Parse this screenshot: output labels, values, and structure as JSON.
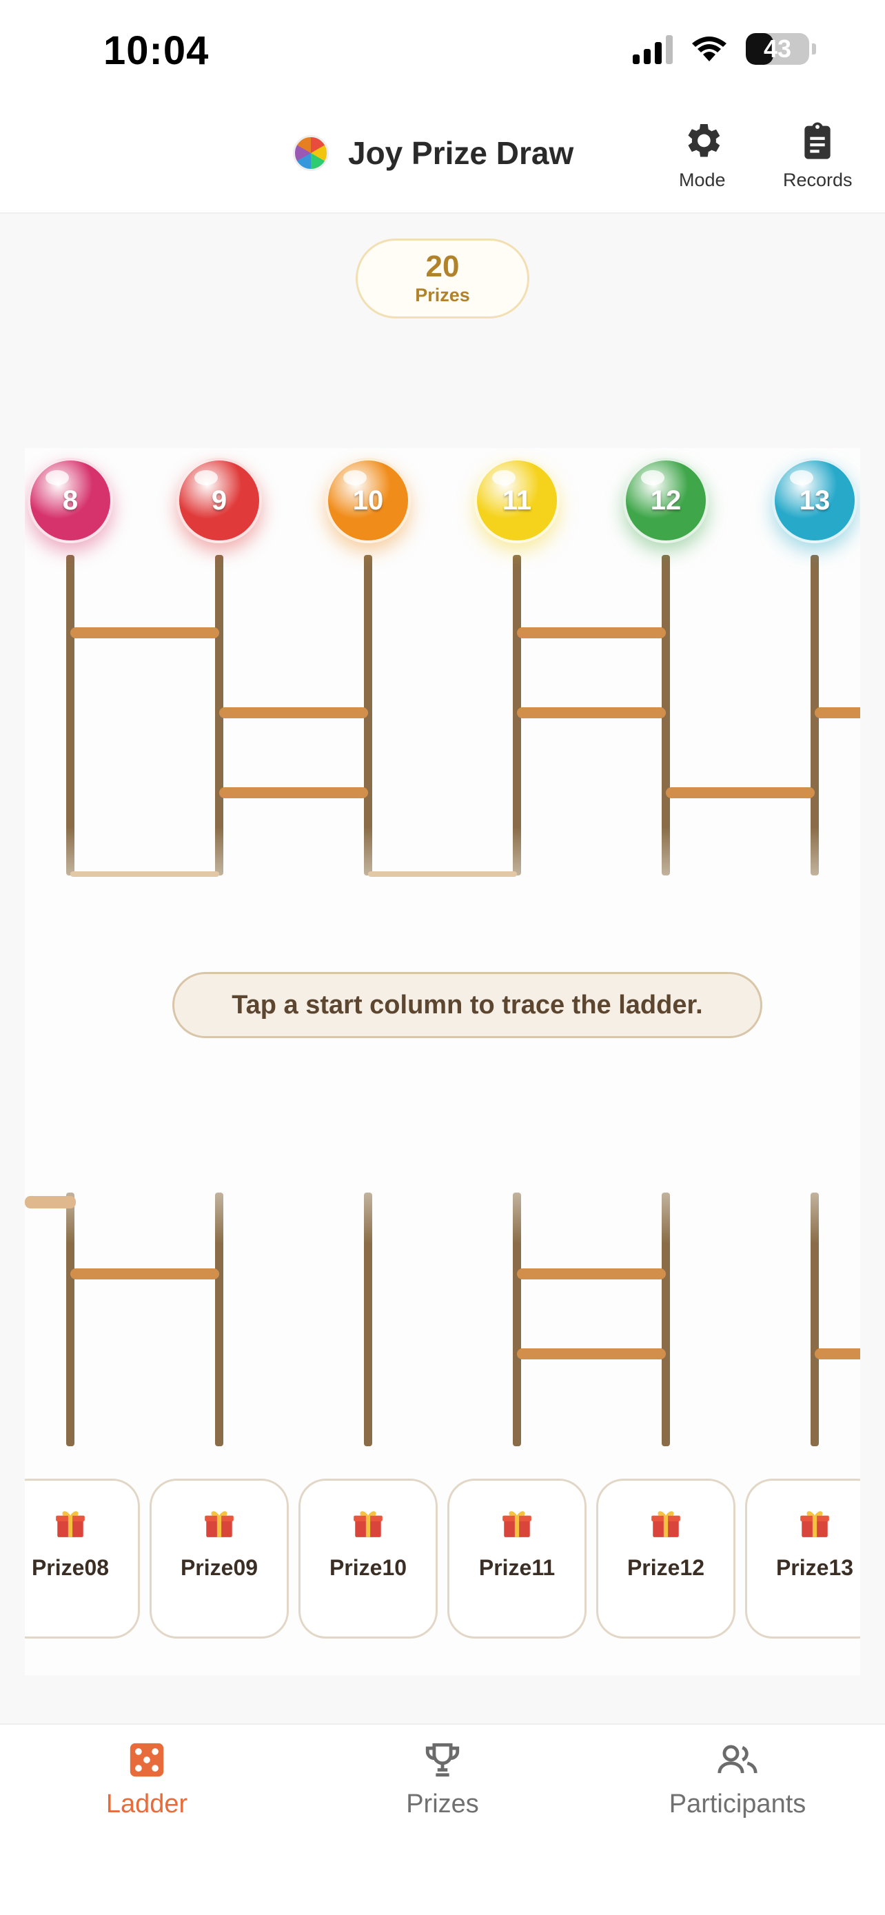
{
  "status": {
    "time": "10:04",
    "battery": "43",
    "battery_level": 0.43
  },
  "header": {
    "title": "Joy Prize Draw",
    "mode_label": "Mode",
    "records_label": "Records"
  },
  "prize_count": {
    "value": "20",
    "label": "Prizes"
  },
  "columns": [
    {
      "number": "8",
      "color": "#d6336c"
    },
    {
      "number": "9",
      "color": "#e03a3a"
    },
    {
      "number": "10",
      "color": "#f08c1a"
    },
    {
      "number": "11",
      "color": "#f5d21c"
    },
    {
      "number": "12",
      "color": "#3fa64a"
    },
    {
      "number": "13",
      "color": "#27a9c9"
    }
  ],
  "hint": "Tap a start column to trace the ladder.",
  "prizes": [
    "Prize08",
    "Prize09",
    "Prize10",
    "Prize11",
    "Prize12",
    "Prize13"
  ],
  "tabs": {
    "ladder": "Ladder",
    "prizes": "Prizes",
    "participants": "Participants"
  },
  "colors": {
    "accent": "#e86c3b",
    "rail": "#8a6d48",
    "rung": "#d28f4c",
    "gold": "#b0822a"
  }
}
